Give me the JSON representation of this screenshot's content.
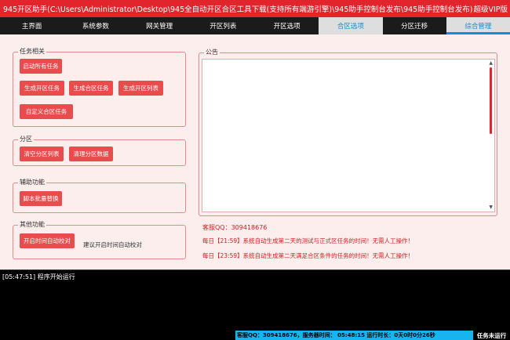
{
  "window": {
    "title": "945开区助手(C:\\Users\\Administrator\\Desktop\\945全自动开区合区工具下载(支持所有端游引擎)\\945助手控制台发布\\945助手控制台发布)",
    "edition": "超级VIP版"
  },
  "tabs": [
    {
      "label": "主界面"
    },
    {
      "label": "系统参数"
    },
    {
      "label": "网关管理"
    },
    {
      "label": "开区列表"
    },
    {
      "label": "开区选项"
    },
    {
      "label": "合区选项"
    },
    {
      "label": "分区迁移"
    },
    {
      "label": "综合管理"
    }
  ],
  "groups": {
    "tasks": {
      "legend": "任务相关",
      "buttons": [
        "启动所有任务",
        "生成开区任务",
        "生成合区任务",
        "生成开区列表",
        "自定义合区任务"
      ]
    },
    "partition": {
      "legend": "分区",
      "buttons": [
        "清空分区列表",
        "清理分区数据"
      ]
    },
    "aux": {
      "legend": "辅助功能",
      "buttons": [
        "脚本批量替换"
      ]
    },
    "other": {
      "legend": "其他功能",
      "buttons": [
        "开启时间自动校对"
      ],
      "hint": "建议开启时间自动校对"
    }
  },
  "notice": {
    "legend": "公告",
    "qq": "客服QQ：309418676",
    "messages": [
      "每日【21:59】系统自动生成第二天的测试与正式区任务的时间！无需人工操作！",
      "每日【23:59】系统自动生成第二天满足合区条件的任务的时间！无需人工操作！"
    ]
  },
  "log": {
    "lines": [
      "[05:47:51] 程序开始运行"
    ]
  },
  "status": {
    "info": "客服QQ：309418676，服务器时间：   05:48:15 运行时长：0天0时0分26秒",
    "task_state": "任务未运行"
  },
  "colors": {
    "accent": "#e2242c",
    "button": "#e84c4c",
    "tab_active_text": "#0e8fd6",
    "status_bar": "#17b4f0"
  }
}
